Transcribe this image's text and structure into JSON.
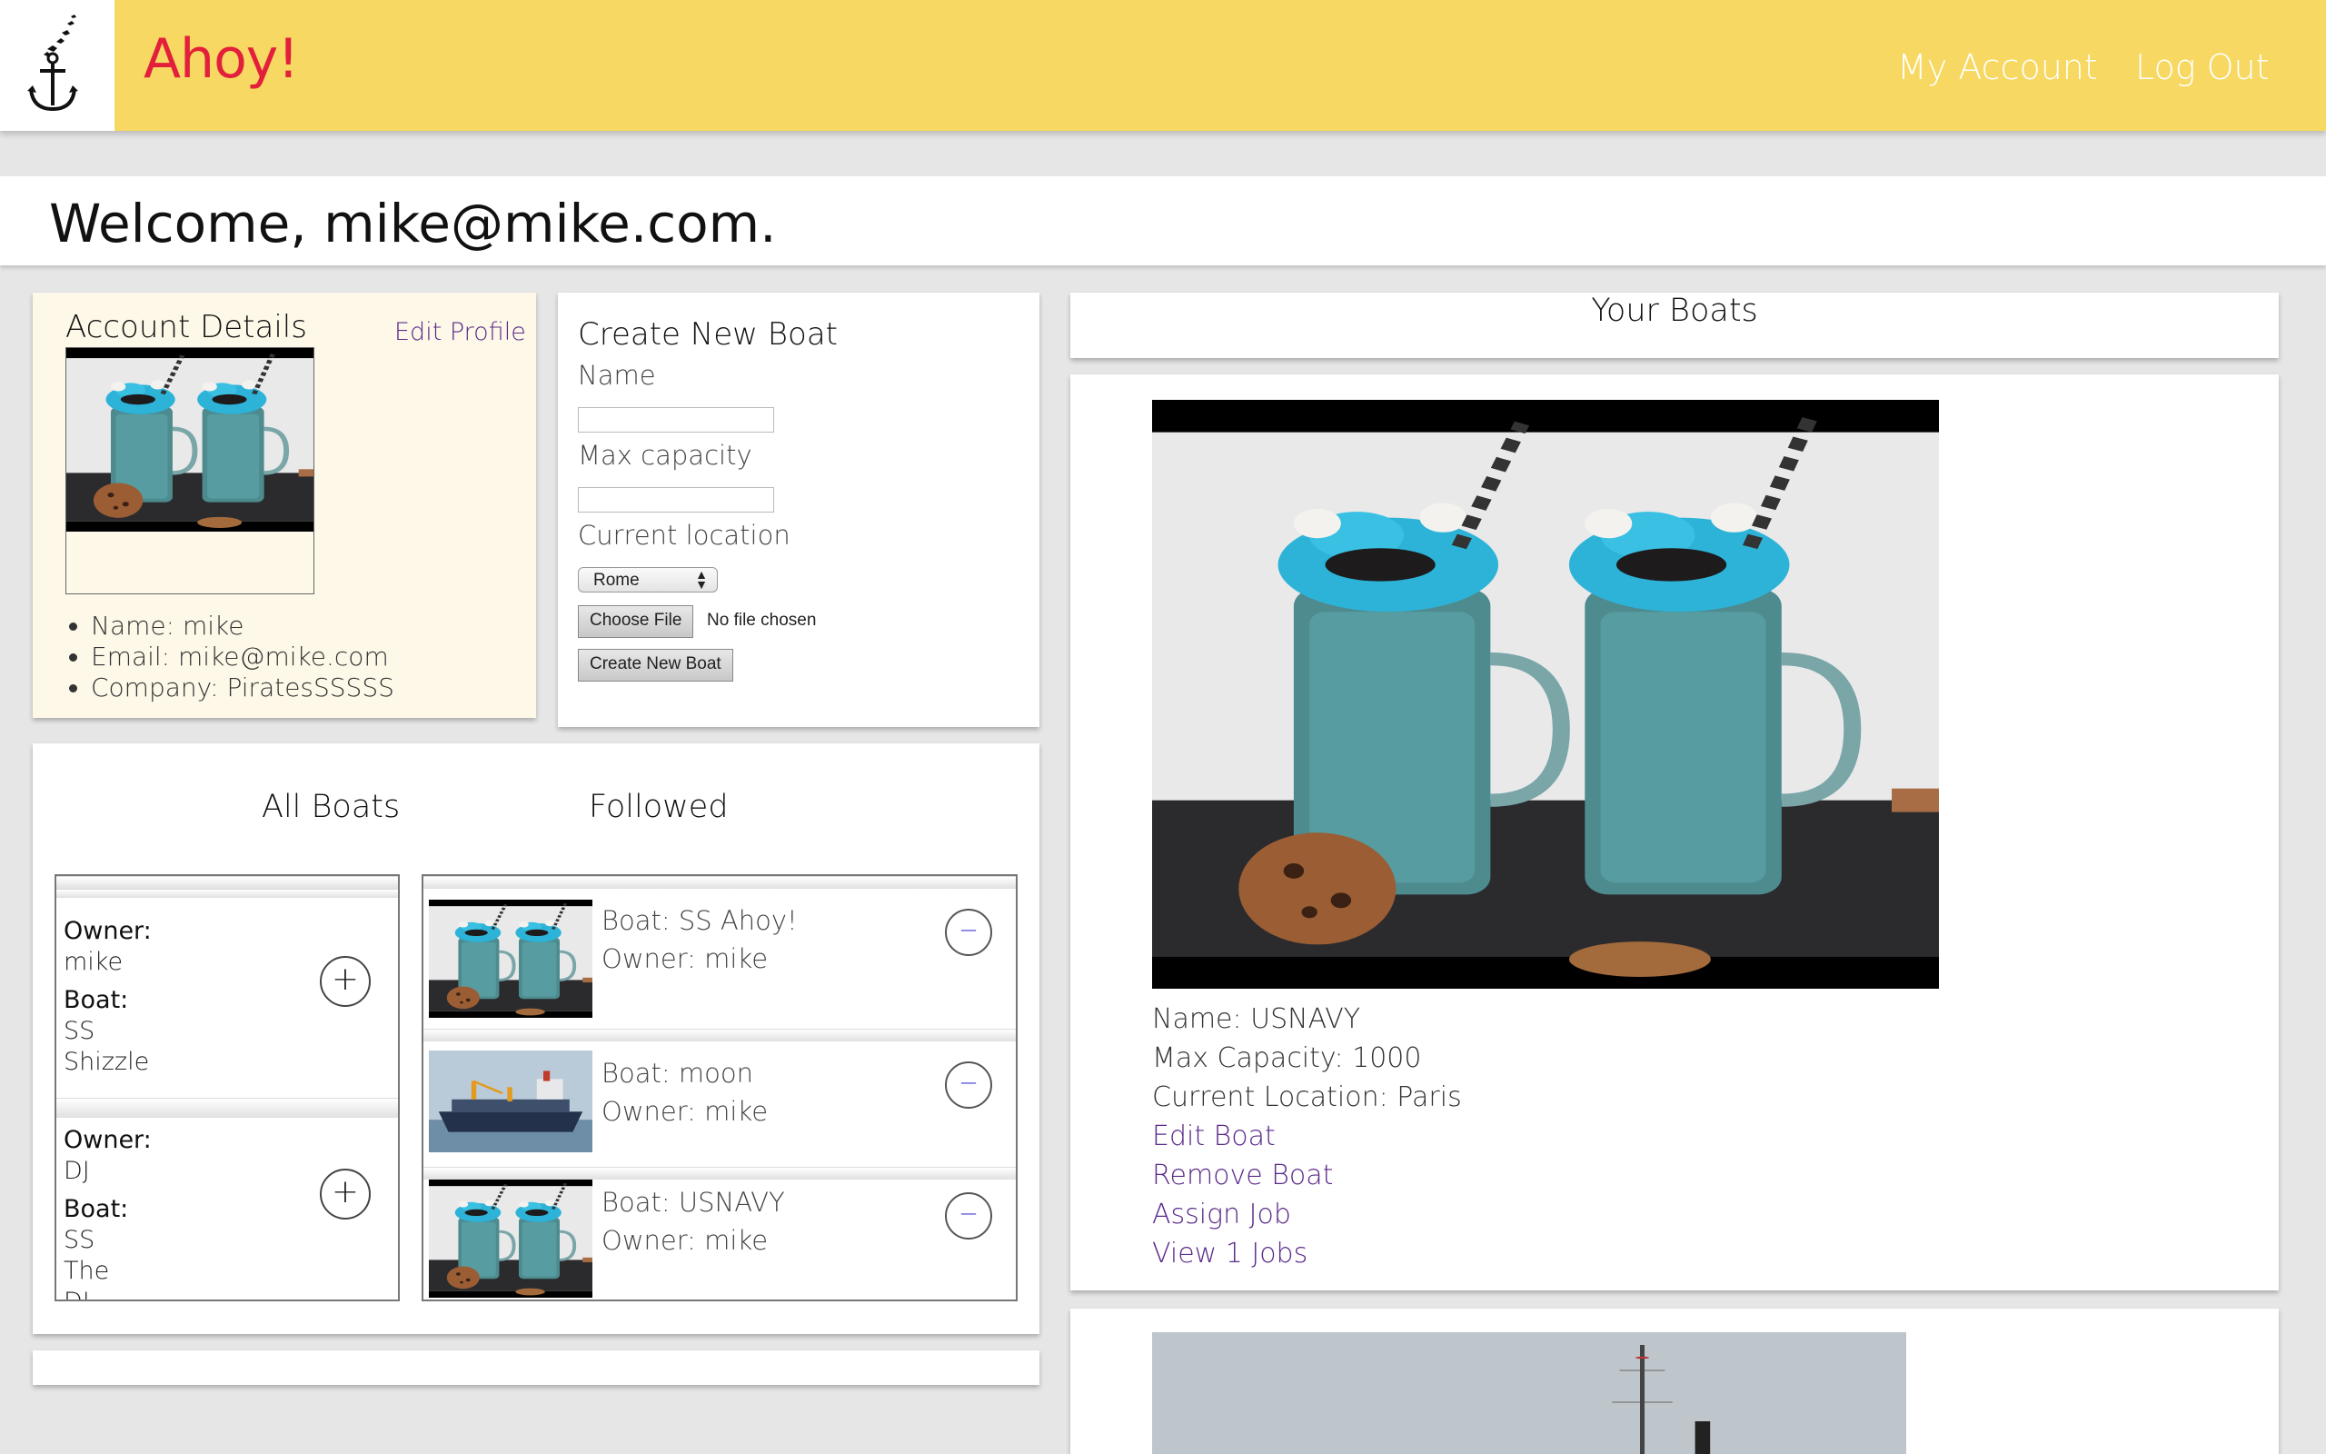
{
  "header": {
    "brand": "Ahoy!",
    "logo_icon": "anchor-icon",
    "nav": {
      "account": "My Account",
      "logout": "Log Out"
    },
    "colors": {
      "bar": "#f7d862",
      "brand": "#e3203b"
    }
  },
  "welcome": {
    "text": "Welcome, mike@mike.com."
  },
  "account": {
    "title": "Account Details",
    "edit_link": "Edit Profile",
    "details": [
      "Name: mike",
      "Email: mike@mike.com",
      "Company: PiratesSSSSS"
    ]
  },
  "create_boat": {
    "title": "Create New Boat",
    "name_label": "Name",
    "capacity_label": "Max capacity",
    "location_label": "Current location",
    "location_selected": "Rome",
    "file_button": "Choose File",
    "file_status": "No file chosen",
    "submit": "Create New Boat"
  },
  "lists": {
    "tab_all": "All Boats",
    "tab_followed": "Followed",
    "all_boats": [
      {
        "owner_key": "Owner:",
        "owner_lines": [
          "mike"
        ],
        "boat_key": "Boat:",
        "boat_lines": [
          "SS",
          "Shizzle"
        ]
      },
      {
        "owner_key": "Owner:",
        "owner_lines": [
          "DJ"
        ],
        "boat_key": "Boat:",
        "boat_lines": [
          "SS",
          "The",
          "DJ"
        ]
      }
    ],
    "add_symbol": "+",
    "remove_symbol": "−",
    "followed": [
      {
        "boat": "Boat: SS Ahoy!",
        "owner": "Owner: mike",
        "image": "milkshake"
      },
      {
        "boat": "Boat: moon",
        "owner": "Owner: mike",
        "image": "ship"
      },
      {
        "boat": "Boat: USNAVY",
        "owner": "Owner: mike",
        "image": "milkshake"
      }
    ]
  },
  "your_boats": {
    "title": "Your Boats",
    "boats": [
      {
        "name": "Name: USNAVY",
        "capacity": "Max Capacity: 1000",
        "location": "Current Location: Paris",
        "actions": [
          "Edit Boat",
          "Remove Boat",
          "Assign Job",
          "View 1 Jobs"
        ]
      }
    ]
  }
}
